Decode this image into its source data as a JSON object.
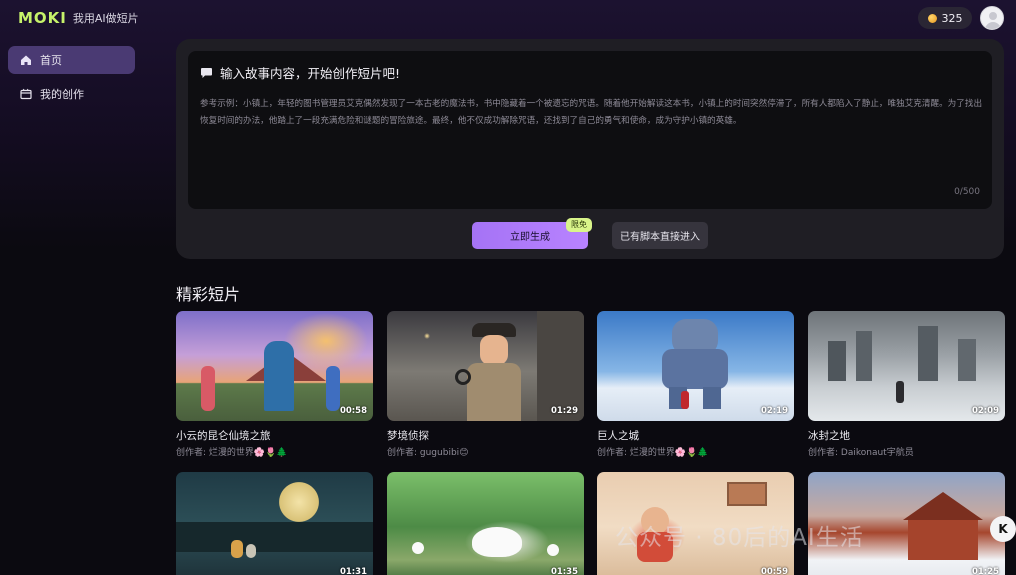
{
  "header": {
    "logo": "MOKI",
    "subtitle": "我用AI做短片",
    "coins": "325"
  },
  "sidebar": {
    "items": [
      {
        "label": "首页",
        "icon": "home-icon",
        "active": true
      },
      {
        "label": "我的创作",
        "icon": "film-box-icon",
        "active": false
      }
    ]
  },
  "composer": {
    "heading": "输入故事内容，开始创作短片吧!",
    "placeholder": "参考示例：小镇上，年轻的图书管理员艾克偶然发现了一本古老的魔法书，书中隐藏着一个被遗忘的咒语。随着他开始解读这本书，小镇上的时间突然停滞了，所有人都陷入了静止，唯独艾克清醒。为了找出恢复时间的办法，他踏上了一段充满危险和谜题的冒险旅途。最终，他不仅成功解除咒语，还找到了自己的勇气和使命，成为守护小镇的英雄。",
    "counter": "0/500",
    "generate_label": "立即生成",
    "free_badge": "限免",
    "script_label": "已有脚本直接进入"
  },
  "gallery": {
    "title": "精彩短片",
    "cards": [
      {
        "title": "小云的昆仑仙境之旅",
        "author": "创作者: 烂漫的世界🌸🌷🌲",
        "duration": "00:58"
      },
      {
        "title": "梦境侦探",
        "author": "创作者: gugubibi😊",
        "duration": "01:29"
      },
      {
        "title": "巨人之城",
        "author": "创作者: 烂漫的世界🌸🌷🌲",
        "duration": "02:19"
      },
      {
        "title": "冰封之地",
        "author": "创作者: Daikonaut宇航员",
        "duration": "02:09"
      },
      {
        "title": "",
        "author": "",
        "duration": "01:31"
      },
      {
        "title": "",
        "author": "",
        "duration": "01:35"
      },
      {
        "title": "",
        "author": "",
        "duration": "00:59"
      },
      {
        "title": "",
        "author": "",
        "duration": "01:25"
      }
    ]
  },
  "watermark": "公众号 · 80后的AI生活",
  "float_button": "K"
}
